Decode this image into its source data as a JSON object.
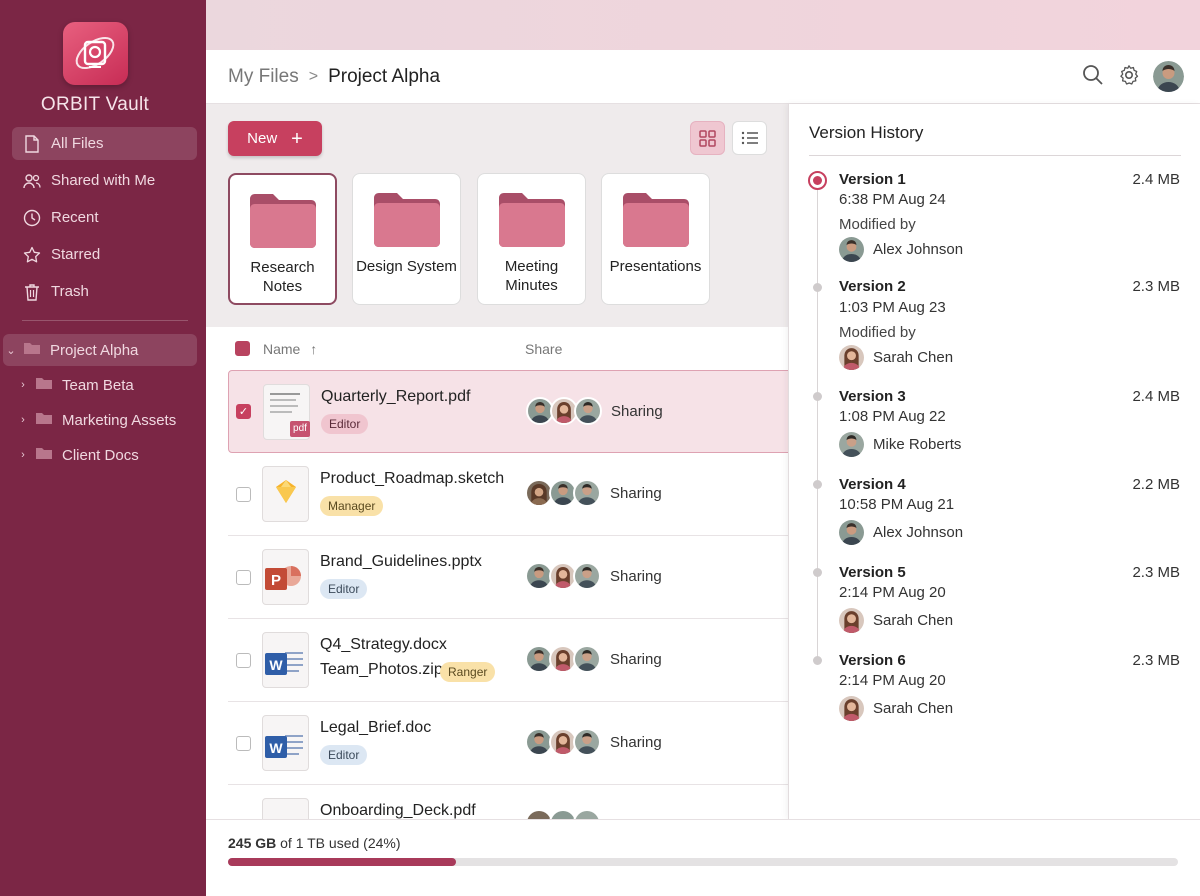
{
  "app": {
    "name": "ORBIT Vault"
  },
  "sidebar": {
    "nav": [
      {
        "label": "All Files",
        "icon": "file-icon"
      },
      {
        "label": "Shared with Me",
        "icon": "users-icon"
      },
      {
        "label": "Recent",
        "icon": "clock-icon"
      },
      {
        "label": "Starred",
        "icon": "star-icon"
      },
      {
        "label": "Trash",
        "icon": "trash-icon"
      }
    ],
    "tree": [
      {
        "label": "Project Alpha",
        "expanded": true
      },
      {
        "label": "Team Beta"
      },
      {
        "label": "Marketing Assets"
      },
      {
        "label": "Client Docs"
      }
    ]
  },
  "breadcrumb": {
    "root": "My Files",
    "separator": ">",
    "current": "Project Alpha"
  },
  "toolbar": {
    "new_label": "New",
    "new_icon": "+"
  },
  "folders": [
    {
      "name": "Research Notes"
    },
    {
      "name": "Design System"
    },
    {
      "name": "Meeting Minutes"
    },
    {
      "name": "Presentations"
    }
  ],
  "list": {
    "col_name": "Name",
    "col_name_sort": "↑",
    "col_share": "Share",
    "rows": [
      {
        "name": "Quarterly_Report.pdf",
        "badge": "Editor",
        "sharing": "Sharing",
        "type": "pdf",
        "selected": true
      },
      {
        "name": "Product_Roadmap.sketch",
        "badge": "Manager",
        "sharing": "Sharing",
        "type": "sketch",
        "selected": false
      },
      {
        "name": "Brand_Guidelines.pptx",
        "badge": "Editor",
        "sharing": "Sharing",
        "type": "pptx",
        "selected": false
      },
      {
        "name": "Q4_Strategy.docx",
        "name2": "Team_Photos.zip",
        "badge": "Ranger",
        "sharing": "Sharing",
        "type": "docx",
        "selected": false
      },
      {
        "name": "Legal_Brief.doc",
        "badge": "Editor",
        "sharing": "Sharing",
        "type": "doc",
        "selected": false
      },
      {
        "name": "Onboarding_Deck.pdf",
        "type": "pdf",
        "selected": false
      }
    ]
  },
  "storage": {
    "used": "245 GB",
    "rest": " of 1 TB used (24%)",
    "fraction": 0.24
  },
  "versions": {
    "title": "Version History",
    "items": [
      {
        "name": "Version 1",
        "size": "2.4 MB",
        "time": "6:38 PM Aug 24",
        "modified_by": "Modified by",
        "user": "Alex Johnson",
        "current": true
      },
      {
        "name": "Version 2",
        "size": "2.3 MB",
        "time": "1:03 PM Aug 23",
        "modified_by": "Modified by",
        "user": "Sarah Chen"
      },
      {
        "name": "Version 3",
        "size": "2.4 MB",
        "time": "1:08 PM Aug 22",
        "user": "Mike Roberts"
      },
      {
        "name": "Version 4",
        "size": "2.2 MB",
        "time": "10:58 PM Aug 21",
        "user": "Alex Johnson"
      },
      {
        "name": "Version 5",
        "size": "2.3 MB",
        "time": "2:14 PM Aug 20",
        "user": "Sarah Chen"
      },
      {
        "name": "Version 6",
        "size": "2.3 MB",
        "time": "2:14 PM Aug 20",
        "user": "Sarah Chen"
      }
    ]
  },
  "colors": {
    "sidebar": "#7b2645",
    "accent": "#c7405f",
    "selected_row": "#f6e2e7"
  }
}
